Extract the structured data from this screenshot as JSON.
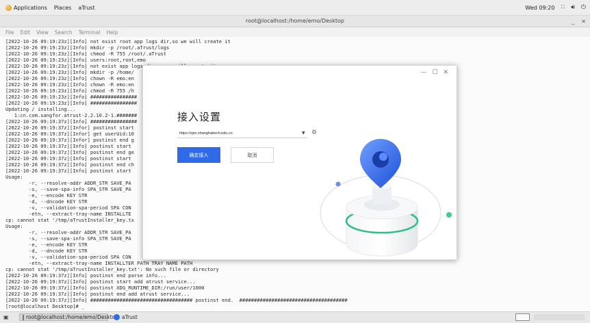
{
  "topbar": {
    "applications": "Applications",
    "places": "Places",
    "app_name": "aTrust",
    "clock": "Wed 09:20"
  },
  "terminal_window": {
    "title": "root@localhost:/home/emo/Desktop",
    "menu": [
      "File",
      "Edit",
      "View",
      "Search",
      "Terminal",
      "Help"
    ],
    "lines": [
      "[2022-10-26 09:19:23z][Info] not exist root app logs dir,so we will create it",
      "[2022-10-26 09:19:23z][Info] mkdir -p /root/.aTrust/logs",
      "[2022-10-26 09:19:23z][Info] chmod -R 755 /root/.aTrust",
      "[2022-10-26 09:19:23z][Info] users:root,root,emo",
      "[2022-10-26 09:19:23z][Info] not exist app logs dir,so we will create it",
      "[2022-10-26 09:19:23z][Info] mkdir -p /home/",
      "[2022-10-26 09:19:23z][Info] chown -R emo:en",
      "[2022-10-26 09:19:23z][Info] chown -R emo:en",
      "[2022-10-26 09:19:23z][Info] chmod -R 755 /h",
      "[2022-10-26 09:19:23z][Info] ################",
      "[2022-10-26 09:19:23z][Info] ################",
      "Updating / installing...",
      "   1:cn.com.sangfor.atrust-2.2.10.2-1.#######",
      "[2022-10-26 09:19:37z][Info] ################",
      "[2022-10-26 09:19:37z][Infor] postinst start",
      "[2022-10-26 09:19:37z][Infor] get userUid:10",
      "[2022-10-26 09:19:37z][Infor] postinst end g",
      "[2022-10-26 09:19:37z][Info] postinst start",
      "[2022-10-26 09:19:37z][Info] postinst end ge",
      "[2022-10-26 09:19:37z][Info] postinst start",
      "[2022-10-26 09:19:37z][Info] postinst end ch",
      "[2022-10-26 09:19:37z][Info] postinst start",
      "Usage:",
      "        -r, --resolve-addr ADDR_STR SAVE_PA",
      "        -s, --save-spa-info SPA_STR SAVE_PA",
      "        -e, --encode KEY STR",
      "        -d, --dncode KEY STR",
      "        -v, --validation-spa-period SPA CON",
      "        -etn, --extract-tray-name INSTALLTE",
      "cp: cannot stat '/tmp/aTrustInstaller_key.tx",
      "Usage:",
      "        -r, --resolve-addr ADDR_STR SAVE_PA",
      "        -s, --save-spa-info SPA_STR SAVE_PA",
      "        -e, --encode KEY STR",
      "        -d, --dncode KEY STR",
      "        -v, --validation-spa-period SPA CON",
      "        -etn, --extract-tray-name INSTALLTER PATH TRAY NAME PATH",
      "cp: cannot stat '/tmp/aTrustInstaller_key.txt': No such file or directory",
      "[2022-10-26 09:19:37z][Info] postinst end parse info...",
      "[2022-10-26 09:19:37z][Info] postinst start add atrust service...",
      "[2022-10-26 09:19:37z][Info] postinst XDG_RUNTIME_DIR:/run/user/1000",
      "[2022-10-26 09:19:37z][Info] postinst end add atrust service...",
      "[2022-10-26 09:19:37z][Info] ################################### postinst end.  #####################################",
      "[root@localhost Desktop]# _"
    ]
  },
  "dialog": {
    "title": "接入设置",
    "url_value": "https://vpn.shanghaitech.edu.cn",
    "confirm_label": "确定接入",
    "cancel_label": "取消",
    "window_controls": [
      "—",
      "☐",
      "✕"
    ],
    "accent_color": "#2f6be6"
  },
  "taskbar": {
    "terminal_task": "root@localhost:/home/emo/Desktop",
    "atrust_task": "aTrust"
  },
  "icons": [
    "applications-icon",
    "network-icon",
    "volume-icon",
    "power-icon",
    "gear-icon",
    "show-desktop-icon",
    "terminal-icon",
    "atrust-icon"
  ]
}
